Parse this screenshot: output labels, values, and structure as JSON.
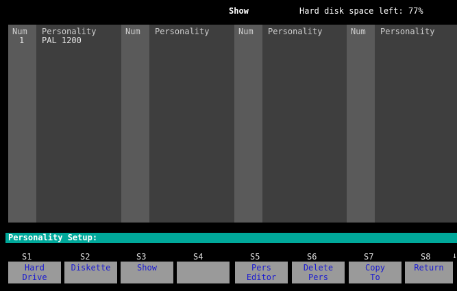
{
  "window": {
    "title": "Show",
    "disk_space": "Hard disk space left: 77%"
  },
  "table": {
    "header_num": "Num",
    "header_personality": "Personality",
    "rows": [
      {
        "num": "1",
        "personality": "PAL 1200"
      }
    ]
  },
  "prompt": {
    "text": "Personality Setup:"
  },
  "softkeys": [
    {
      "id": "S1",
      "label": "Hard\nDrive"
    },
    {
      "id": "S2",
      "label": "Diskette"
    },
    {
      "id": "S3",
      "label": "Show"
    },
    {
      "id": "S4",
      "label": ""
    },
    {
      "id": "S5",
      "label": "Pers\nEditor"
    },
    {
      "id": "S6",
      "label": "Delete\nPers"
    },
    {
      "id": "S7",
      "label": "Copy\nTo"
    },
    {
      "id": "S8",
      "label": "Return"
    }
  ],
  "colors": {
    "background": "#000000",
    "prompt_bar": "#00a89a",
    "softkey_bg": "#9a9a9a",
    "softkey_text": "#1a1ad0"
  }
}
